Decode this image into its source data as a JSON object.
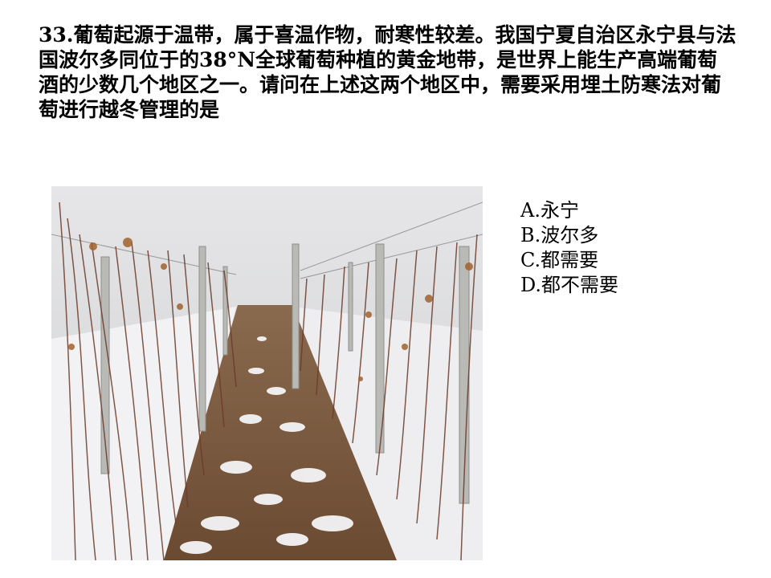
{
  "question": {
    "text": "33.葡萄起源于温带，属于喜温作物，耐寒性较差。我国宁夏自治区永宁县与法国波尔多同位于的38°N全球葡萄种植的黄金地带，是世界上能生产高端葡萄酒的少数几个地区之一。请问在上述这两个地区中，需要采用埋土防寒法对葡萄进行越冬管理的是"
  },
  "options": [
    {
      "letter": "A.",
      "label": "永宁"
    },
    {
      "letter": "B.",
      "label": "波尔多"
    },
    {
      "letter": "C.",
      "label": "都需要"
    },
    {
      "letter": "D.",
      "label": "都不需要"
    }
  ],
  "photo": {
    "subject": "snow-covered-vineyard-with-buried-vines-icon"
  }
}
